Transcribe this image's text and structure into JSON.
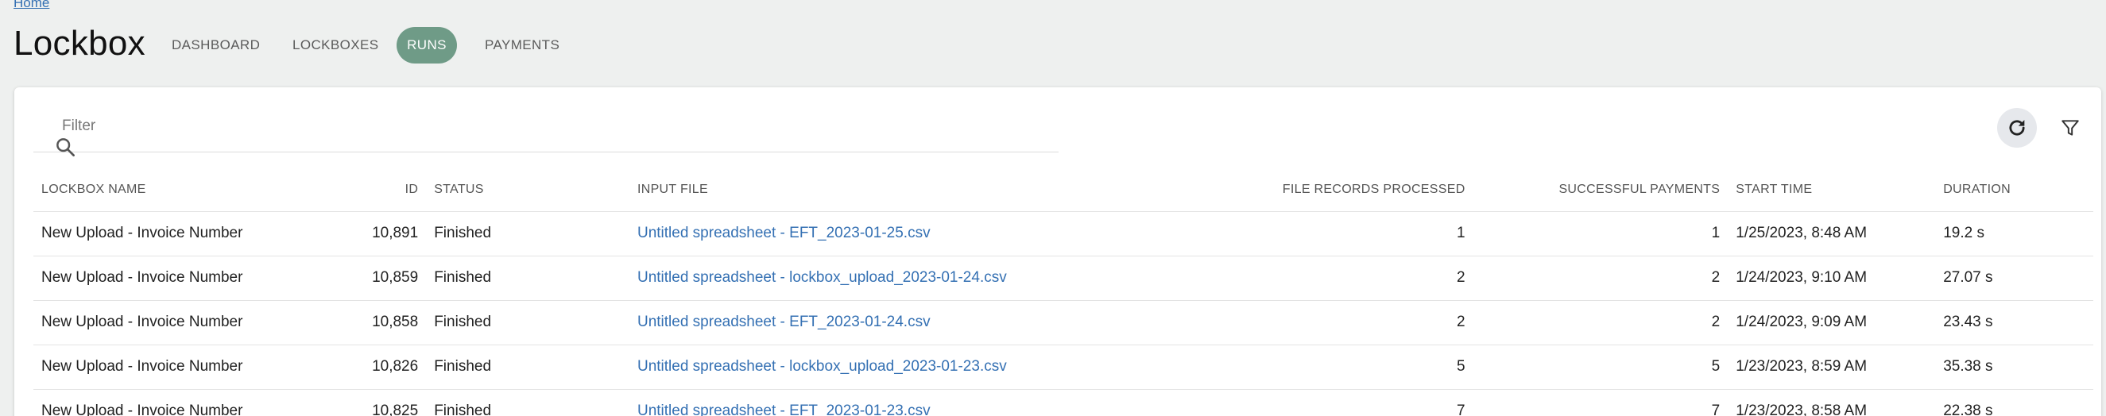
{
  "breadcrumb": {
    "label": "Home"
  },
  "app": {
    "title": "Lockbox"
  },
  "nav": [
    {
      "label": "DASHBOARD",
      "active": false
    },
    {
      "label": "LOCKBOXES",
      "active": false
    },
    {
      "label": "RUNS",
      "active": true
    },
    {
      "label": "PAYMENTS",
      "active": false
    }
  ],
  "toolbar": {
    "filter_placeholder": "Filter",
    "filter_value": "",
    "refresh_icon": "refresh-icon",
    "filter_icon": "funnel-icon"
  },
  "table": {
    "columns": [
      "LOCKBOX NAME",
      "ID",
      "STATUS",
      "INPUT FILE",
      "FILE RECORDS PROCESSED",
      "SUCCESSFUL PAYMENTS",
      "START TIME",
      "DURATION"
    ],
    "rows": [
      {
        "lockbox_name": "New Upload - Invoice Number",
        "id": "10,891",
        "status": "Finished",
        "input_file": "Untitled spreadsheet - EFT_2023-01-25.csv",
        "file_records": "1",
        "successful_payments": "1",
        "start_time": "1/25/2023, 8:48 AM",
        "duration": "19.2 s"
      },
      {
        "lockbox_name": "New Upload - Invoice Number",
        "id": "10,859",
        "status": "Finished",
        "input_file": "Untitled spreadsheet - lockbox_upload_2023-01-24.csv",
        "file_records": "2",
        "successful_payments": "2",
        "start_time": "1/24/2023, 9:10 AM",
        "duration": "27.07 s"
      },
      {
        "lockbox_name": "New Upload - Invoice Number",
        "id": "10,858",
        "status": "Finished",
        "input_file": "Untitled spreadsheet - EFT_2023-01-24.csv",
        "file_records": "2",
        "successful_payments": "2",
        "start_time": "1/24/2023, 9:09 AM",
        "duration": "23.43 s"
      },
      {
        "lockbox_name": "New Upload - Invoice Number",
        "id": "10,826",
        "status": "Finished",
        "input_file": "Untitled spreadsheet - lockbox_upload_2023-01-23.csv",
        "file_records": "5",
        "successful_payments": "5",
        "start_time": "1/23/2023, 8:59 AM",
        "duration": "35.38 s"
      },
      {
        "lockbox_name": "New Upload - Invoice Number",
        "id": "10,825",
        "status": "Finished",
        "input_file": "Untitled spreadsheet - EFT_2023-01-23.csv",
        "file_records": "7",
        "successful_payments": "7",
        "start_time": "1/23/2023, 8:58 AM",
        "duration": "22.38 s"
      }
    ]
  },
  "colors": {
    "accent": "#6f9b87",
    "link": "#3470b3",
    "background": "#eef0ef"
  }
}
